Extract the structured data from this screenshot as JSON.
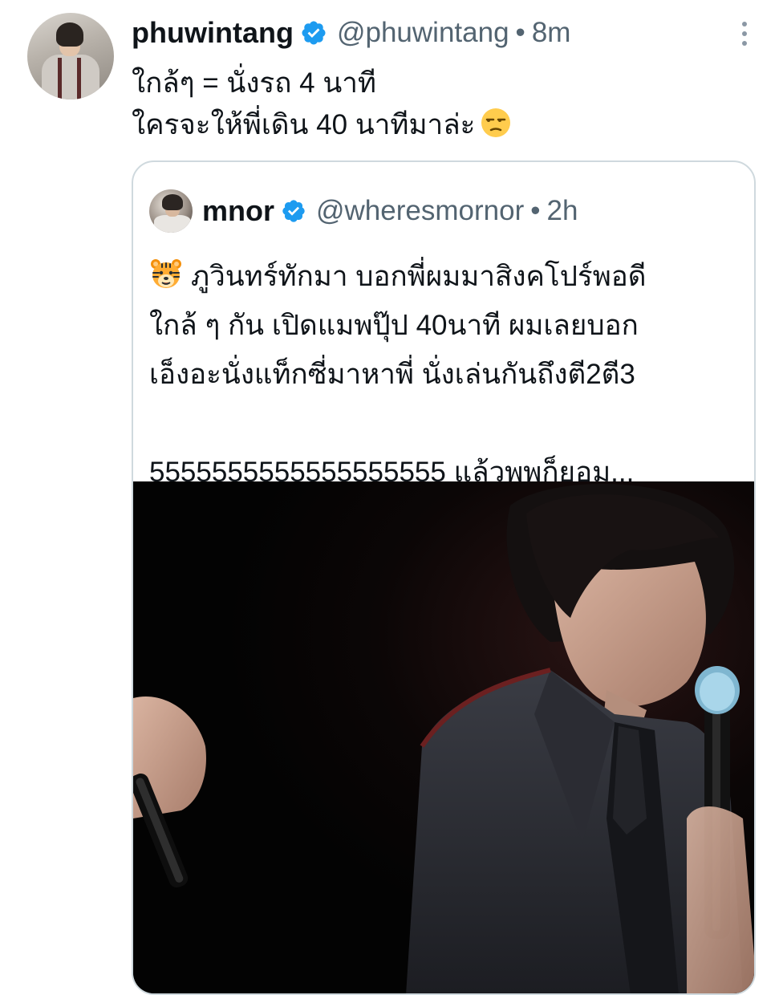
{
  "tweet": {
    "display_name": "phuwintang",
    "handle": "@phuwintang",
    "separator": "•",
    "time": "8m",
    "lines": [
      "ใกล้ๆ = นั่งรถ 4 นาที",
      "ใครจะให้พี่เดิน 40 นาทีมาล่ะ"
    ],
    "emoji": "unamused-face",
    "verified_color": "#1d9bf0"
  },
  "quote": {
    "display_name": "mnor",
    "handle": "@wheresmornor",
    "separator": "•",
    "time": "2h",
    "emoji": "tiger-face",
    "lines": [
      "ภูวินทร์ทักมา บอกพี่ผมมาสิงคโปร์พอดี",
      "ใกล้ ๆ กัน เปิดแมพปุ๊ป 40นาที ผมเลยบอก",
      "เอ็งอะนั่งแท็กซี่มาหาพี่ นั่งเล่นกันถึงตี2ตี3",
      "",
      "5555555555555555555 แล้วพุพุก็ยอม..."
    ]
  }
}
